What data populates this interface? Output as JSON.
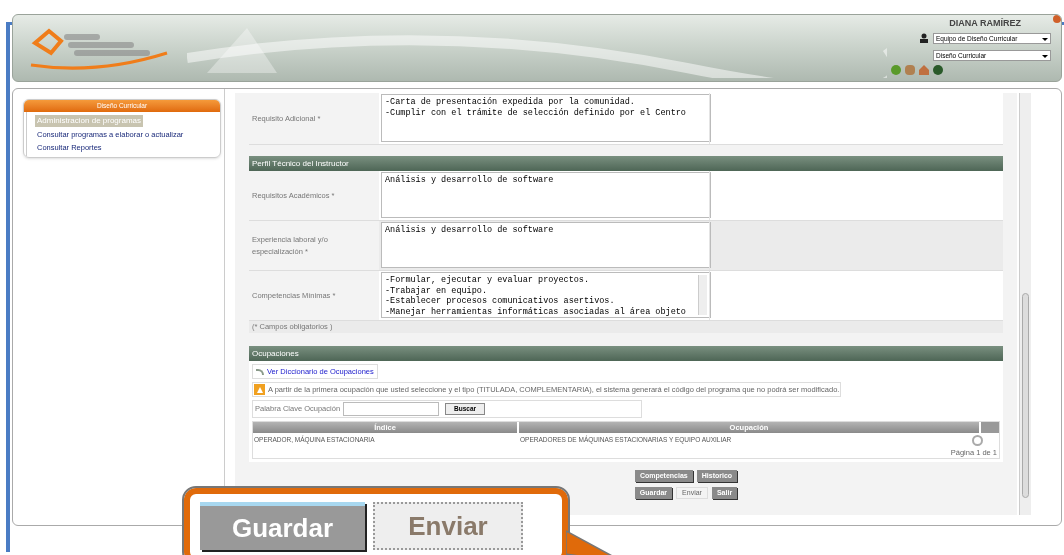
{
  "header": {
    "user_name": "DIANA RAMÍREZ",
    "role_select": "Equipo de Diseño Curricular",
    "area_select": "Diseño Curricular"
  },
  "sidebar": {
    "title": "Diseño Curricular",
    "items": [
      {
        "label": "Administracion de programas",
        "selected": true
      },
      {
        "label": "Consultar programas a elaborar o actualizar",
        "selected": false
      },
      {
        "label": "Consultar Reportes",
        "selected": false
      }
    ]
  },
  "additional": {
    "label": "Requisito Adicional *",
    "value": "-Carta de presentación expedida por la comunidad.\n-Cumplir con el trámite de selección definido por el Centro"
  },
  "profile": {
    "title": "Perfil Técnico del Instructor",
    "fields": [
      {
        "label": "Requisitos Académicos *",
        "value": "Análisis y desarrollo de software",
        "scroll": false
      },
      {
        "label": "Experiencia laboral y/o especialización *",
        "value": "Análisis y desarrollo de software",
        "scroll": false
      },
      {
        "label": "Competencias Mínimas *",
        "value": "-Formular, ejecutar y evaluar proyectos.\n-Trabajar en equipo.\n-Establecer procesos comunicativos asertivos.\n-Manejar herramientas informáticas asociadas al área objeto",
        "scroll": true
      }
    ],
    "note": "(* Campos obligatorios )"
  },
  "occupations": {
    "title": "Ocupaciones",
    "dictionary_link": "Ver Diccionario de Ocupaciones",
    "warning": "A partir de la primera ocupación que usted seleccione y el tipo (TITULADA, COMPLEMENTARIA), el sistema generará el código del programa que no podrá ser modificado.",
    "search_label": "Palabra Clave Ocupación",
    "search_button": "Buscar",
    "table": {
      "columns": [
        "Índice",
        "Ocupación"
      ],
      "rows": [
        {
          "cells": [
            "OPERADOR, MÁQUINA ESTACIONARIA",
            "OPERADORES DE MÁQUINAS ESTACIONARIAS Y EQUIPO AUXILIAR"
          ]
        }
      ],
      "pagination": "Página 1 de 1"
    }
  },
  "actions": [
    [
      {
        "label": "Competencias",
        "disabled": false
      },
      {
        "label": "Historico",
        "disabled": false
      }
    ],
    [
      {
        "label": "Guardar",
        "disabled": false
      },
      {
        "label": "Enviar",
        "disabled": true
      },
      {
        "label": "Salir",
        "disabled": false
      }
    ]
  ],
  "callout": {
    "buttons": [
      {
        "label": "Guardar",
        "disabled": false
      },
      {
        "label": "Enviar",
        "disabled": true
      }
    ]
  }
}
